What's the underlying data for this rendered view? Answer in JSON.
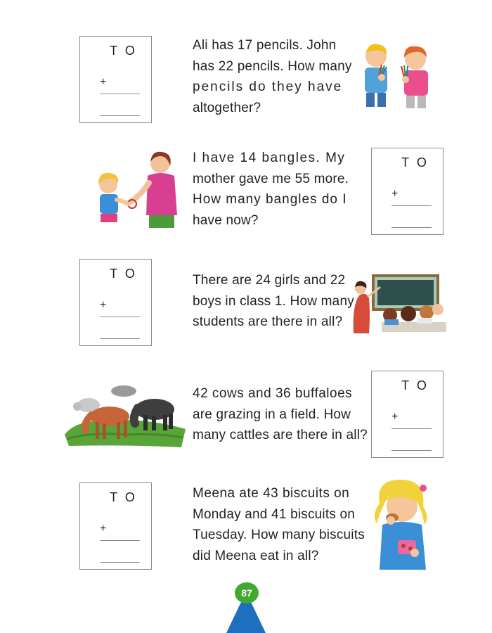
{
  "problems": [
    {
      "box": {
        "header": "T O",
        "plus": "+"
      },
      "lines": [
        "Ali has 17 pencils. John",
        "has 22 pencils. How many",
        "pencils do they have",
        "altogether?"
      ],
      "illustration": "two-boys-with-pencils"
    },
    {
      "box": {
        "header": "T O",
        "plus": "+"
      },
      "lines": [
        "I have 14 bangles. My",
        "mother gave me 55 more.",
        "How many bangles do I",
        "have now?"
      ],
      "illustration": "mother-giving-bangles-to-girl"
    },
    {
      "box": {
        "header": "T O",
        "plus": "+"
      },
      "lines": [
        "There are 24 girls and 22",
        "boys in class 1. How many",
        "students are there in all?"
      ],
      "illustration": "teacher-and-students-classroom"
    },
    {
      "box": {
        "header": "T O",
        "plus": "+"
      },
      "lines": [
        "42 cows and 36 buffaloes",
        "are grazing in a field. How",
        "many cattles are there in all?"
      ],
      "illustration": "cows-and-buffaloes-grazing"
    },
    {
      "box": {
        "header": "T O",
        "plus": "+"
      },
      "lines": [
        "Meena ate 43 biscuits on",
        "Monday and 41 biscuits on",
        "Tuesday. How many biscuits",
        "did Meena eat in all?"
      ],
      "illustration": "girl-eating-biscuits"
    }
  ],
  "page_number": "87",
  "colors": {
    "text": "#231f20",
    "page_badge": "#43a82f",
    "page_mountain": "#1f6fc1"
  }
}
